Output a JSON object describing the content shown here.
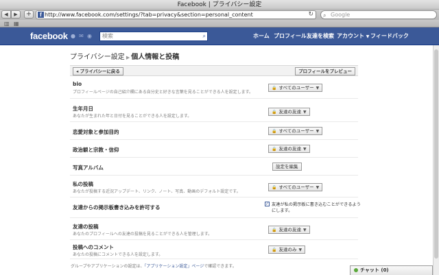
{
  "browser": {
    "window_title": "Facebook | プライバシー設定",
    "url": "http://www.facebook.com/settings/?tab=privacy&section=personal_content",
    "search_placeholder": "Google"
  },
  "fb_header": {
    "logo": "facebook",
    "search_placeholder": "検索",
    "nav": {
      "home": "ホーム",
      "profile": "プロフィール",
      "find_friends": "友達を検索",
      "account": "アカウント",
      "feedback": "フィードバック"
    }
  },
  "breadcrumb": {
    "parent": "プライバシー設定",
    "current": "個人情報と投稿"
  },
  "toolbar": {
    "back_label": "プライバシーに戻る",
    "preview_label": "プロフィールをプレビュー"
  },
  "rows": [
    {
      "title": "bio",
      "desc": "プロフィールページの自己紹介欄にある自分史と好きな言葉を見ることができる人を設定します。",
      "control": "すべてのユーザー"
    },
    {
      "title": "生年月日",
      "desc": "あなたが生まれた年と日付を見ることができる人を設定します。",
      "control": "友達の友達"
    },
    {
      "title": "恋愛対象と参加目的",
      "desc": "",
      "control": "すべてのユーザー"
    },
    {
      "title": "政治観と宗教・信仰",
      "desc": "",
      "control": "友達の友達"
    },
    {
      "title": "写真アルバム",
      "desc": "",
      "control": "設定を編集"
    },
    {
      "title": "私の投稿",
      "desc": "あなたが投稿する近況アップデート、リンク、ノート、写真、動画のデフォルト設定です。",
      "control": "すべてのユーザー"
    },
    {
      "title": "友達からの掲示板書き込みを許可する",
      "desc": "",
      "control": "友達が私の掲示板に書き込むことができるようにします。"
    },
    {
      "title": "友達の投稿",
      "desc": "あなたのプロフィールへの友達の投稿を見ることができる人を管理します。",
      "control": "友達の友達"
    },
    {
      "title": "投稿へのコメント",
      "desc": "あなたの投稿にコメントできる人を設定します。",
      "control": "友達のみ"
    }
  ],
  "footer": {
    "prefix": "グループやアプリケーションの設定は、",
    "link": "「アプリケーション設定」ページ",
    "suffix": "で確認できます。"
  },
  "chat": {
    "label": "チャット (0)"
  },
  "colors": {
    "brand": "#3b5998",
    "brand_border": "#133783"
  }
}
